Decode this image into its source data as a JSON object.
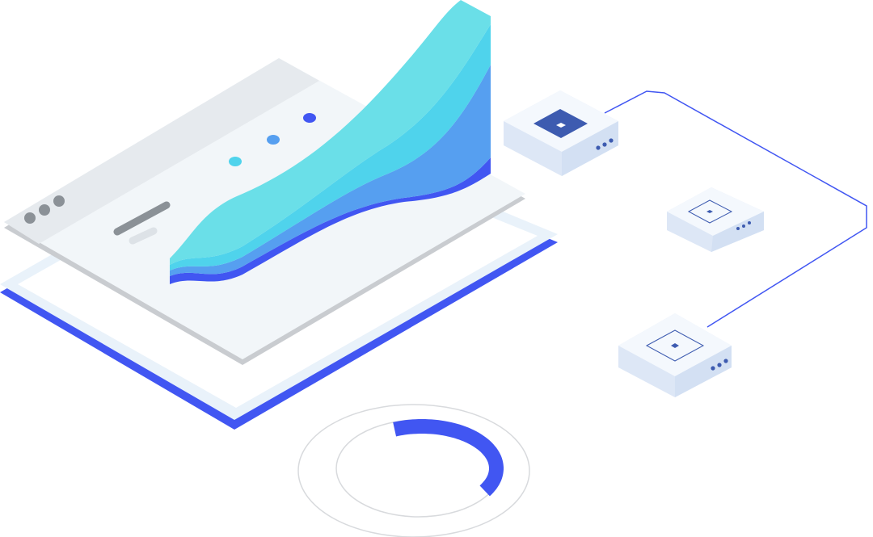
{
  "colors": {
    "accent_blue": "#4156f2",
    "cyan_light": "#6adfe8",
    "cyan": "#4fd3ec",
    "sky_blue": "#569ff0",
    "panel": "#f2f6f9",
    "panel_header": "#e6eaee",
    "server_face": "#eaf1fb",
    "server_chip": "#3d5bb0"
  },
  "progress_ring": {
    "fill_percent": 40
  },
  "window_dots": 3,
  "server_count": 3
}
